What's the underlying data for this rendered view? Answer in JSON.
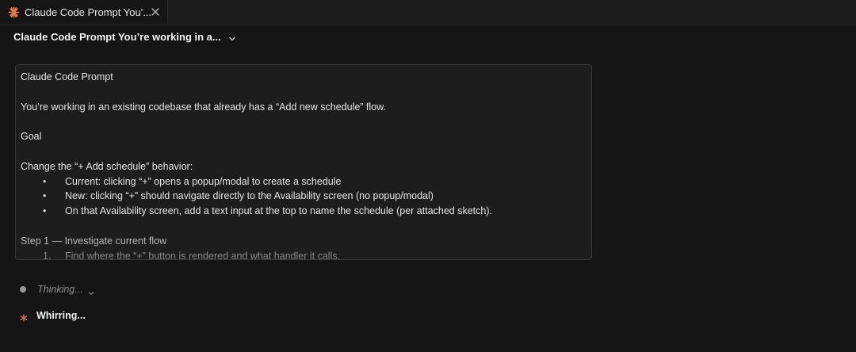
{
  "tab": {
    "title": "Claude Code Prompt You'...",
    "icon": "claude-asterisk-icon",
    "close_icon": "close-icon",
    "accent": "#e0764f"
  },
  "header": {
    "title": "Claude Code Prompt You’re working in a...",
    "chevron_icon": "chevron-down-icon"
  },
  "prompt": {
    "line1": "Claude Code Prompt",
    "line2": "You’re working in an existing codebase that already has a “Add new schedule” flow.",
    "line3": "Goal",
    "line4": "Change the “+ Add schedule” behavior:",
    "bullet_mark": "•",
    "bullets": [
      "Current: clicking “+” opens a popup/modal to create a schedule",
      "New: clicking “+” should navigate directly to the Availability screen (no popup/modal)",
      "On that Availability screen, add a text input at the top to name the schedule (per attached sketch)."
    ],
    "line5": "Step 1 — Investigate current flow",
    "numbered": [
      {
        "num": "1.",
        "text": "Find where the “+” button is rendered and what handler it calls."
      }
    ]
  },
  "status": {
    "thinking_label": "Thinking...",
    "thinking_chevron": "chevron-down-icon",
    "whirring_label": "Whirring...",
    "whirring_icon": "spark-icon"
  }
}
